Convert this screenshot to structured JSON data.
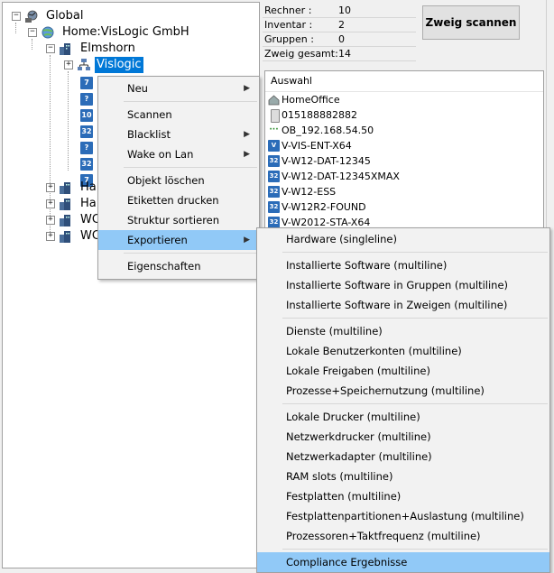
{
  "tree": {
    "nodes": [
      {
        "label": "Global",
        "icon": "globe-network-icon"
      },
      {
        "label": "Home:VisLogic GmbH",
        "icon": "globe-icon"
      },
      {
        "label": "Elmshorn",
        "icon": "building-icon"
      },
      {
        "label": "Vislogic",
        "icon": "network-group-icon"
      },
      {
        "label": "Ha",
        "icon": "building-icon"
      },
      {
        "label": "Ha",
        "icon": "building-icon"
      },
      {
        "label": "WC",
        "icon": "building-icon"
      },
      {
        "label": "WC",
        "icon": "building-icon"
      }
    ],
    "device_badges": [
      "7",
      "?",
      "10",
      "32",
      "?",
      "32",
      "7"
    ]
  },
  "info": {
    "rows": [
      {
        "label": "Rechner  :",
        "value": "10"
      },
      {
        "label": "Inventar  :",
        "value": "2"
      },
      {
        "label": "Gruppen  :",
        "value": "0"
      },
      {
        "label": "Zweig gesamt:",
        "value": "14"
      }
    ],
    "scan_button": "Zweig scannen"
  },
  "auswahl": {
    "header": "Auswahl",
    "items": [
      {
        "label": "HomeOffice",
        "badge": ""
      },
      {
        "label": "015188882882",
        "badge": ""
      },
      {
        "label": "OB_192.168.54.50",
        "badge": ""
      },
      {
        "label": "V-VIS-ENT-X64",
        "badge": "V"
      },
      {
        "label": "V-W12-DAT-12345",
        "badge": "32"
      },
      {
        "label": "V-W12-DAT-12345XMAX",
        "badge": "32"
      },
      {
        "label": "V-W12-ESS",
        "badge": "32"
      },
      {
        "label": "V-W12R2-FOUND",
        "badge": "32"
      },
      {
        "label": "V-W2012-STA-X64",
        "badge": "32"
      }
    ]
  },
  "context_menu": {
    "neu": "Neu",
    "scannen": "Scannen",
    "blacklist": "Blacklist",
    "wake_on_lan": "Wake on Lan",
    "objekt_loeschen": "Objekt löschen",
    "etiketten_drucken": "Etiketten drucken",
    "struktur_sortieren": "Struktur sortieren",
    "exportieren": "Exportieren",
    "eigenschaften": "Eigenschaften"
  },
  "export_menu": {
    "groups": [
      [
        "Hardware (singleline)"
      ],
      [
        "Installierte Software (multiline)",
        "Installierte Software in Gruppen (multiline)",
        "Installierte Software in Zweigen (multiline)"
      ],
      [
        "Dienste (multiline)",
        "Lokale Benutzerkonten (multiline)",
        "Lokale Freigaben (multiline)",
        "Prozesse+Speichernutzung (multiline)"
      ],
      [
        "Lokale Drucker (multiline)",
        "Netzwerkdrucker (multiline)",
        "Netzwerkadapter (multiline)",
        "RAM slots (multiline)",
        "Festplatten (multiline)",
        "Festplattenpartitionen+Auslastung (multiline)",
        "Prozessoren+Taktfrequenz (multiline)"
      ],
      [
        "Compliance Ergebnisse"
      ]
    ]
  },
  "colors": {
    "selection": "#0078d7",
    "menu_highlight": "#91c9f7",
    "device_badge": "#2b6cb8"
  }
}
